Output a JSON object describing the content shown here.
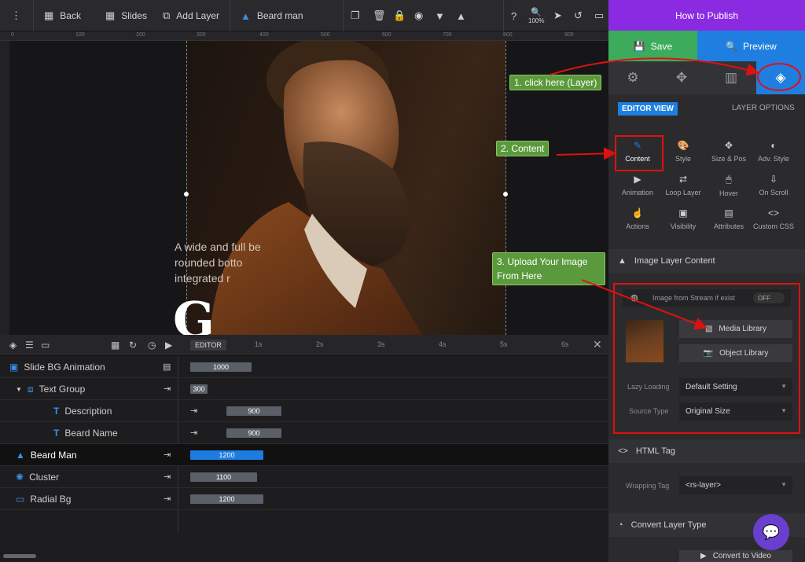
{
  "toolbar": {
    "back": "Back",
    "slides": "Slides",
    "add_layer": "Add Layer",
    "layer_name": "Beard man",
    "zoom": "100%"
  },
  "ruler": [
    "0",
    "100",
    "200",
    "300",
    "400",
    "500",
    "600",
    "700",
    "800",
    "900"
  ],
  "canvas": {
    "desc": "A wide and full be\nrounded botto\nintegrated r",
    "big": "G"
  },
  "timeline": {
    "editor": "EDITOR",
    "times": [
      "1s",
      "2s",
      "3s",
      "4s",
      "5s",
      "6s"
    ],
    "rows": [
      {
        "name": "Slide BG Animation",
        "value": "1000"
      },
      {
        "name": "Text Group",
        "value": "300"
      },
      {
        "name": "Description",
        "value": "900"
      },
      {
        "name": "Beard Name",
        "value": "900"
      },
      {
        "name": "Beard Man",
        "value": "1200"
      },
      {
        "name": "Cluster",
        "value": "1100"
      },
      {
        "name": "Radial Bg",
        "value": "1200"
      }
    ]
  },
  "panel": {
    "title": "How to Publish",
    "save": "Save",
    "preview": "Preview",
    "editor_view": "EDITOR VIEW",
    "layer_options": "LAYER OPTIONS",
    "options": [
      "Content",
      "Style",
      "Size & Pos",
      "Adv. Style",
      "Animation",
      "Loop Layer",
      "Hover",
      "On Scroll",
      "Actions",
      "Visibility",
      "Attributes",
      "Custom CSS"
    ],
    "image_section": "Image Layer Content",
    "stream": "Image from Stream if exist",
    "stream_toggle": "OFF",
    "media_library": "Media Library",
    "object_library": "Object Library",
    "lazy_label": "Lazy Loading",
    "lazy_value": "Default Setting",
    "source_label": "Source Type",
    "source_value": "Original Size",
    "html_tag": "HTML Tag",
    "wrapping_label": "Wrapping Tag",
    "wrapping_value": "<rs-layer>",
    "convert_type": "Convert Layer Type",
    "convert_video": "Convert to Video"
  },
  "annotations": {
    "a1": "1. click here (Layer)",
    "a2": "2. Content",
    "a3": "3. Upload Your Image From Here"
  },
  "colors": {
    "accent_purple": "#8a2be2",
    "save_green": "#3dab5c",
    "preview_blue": "#1f7fe0",
    "active_bar": "#1e7be0",
    "annotation_green": "#5b9a3c",
    "highlight_red": "#e01010"
  }
}
